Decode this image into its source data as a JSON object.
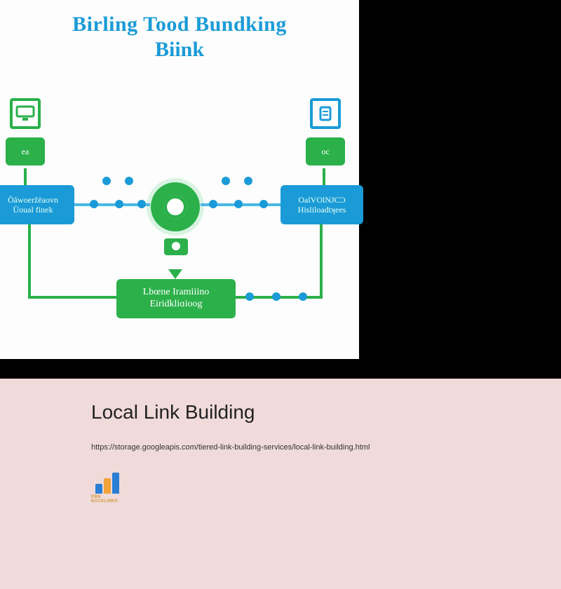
{
  "colors": {
    "blue": "#1a9bd7",
    "green": "#2bb04a",
    "panel_bg": "#f0dada"
  },
  "infographic": {
    "title_line1": "Birling Tood Bundking",
    "title_line2": "Biink",
    "left_badge": "ea",
    "right_badge": "oc",
    "left_box_line1": "Öǎwoeržëaovn",
    "left_box_line2": "Üoual finek",
    "right_box_line1": "OalVOlNJCƆ",
    "right_box_line2": "Hisliloadtʞees",
    "bottom_box_line1": "Lbœne Iramiiino",
    "bottom_box_line2": "Eiridkliɑioog"
  },
  "page": {
    "title": "Local Link Building",
    "url": "https://storage.googleapis.com/tiered-link-building-services/local-link-building.html",
    "logo_text": "PBN BACKLINKS"
  }
}
